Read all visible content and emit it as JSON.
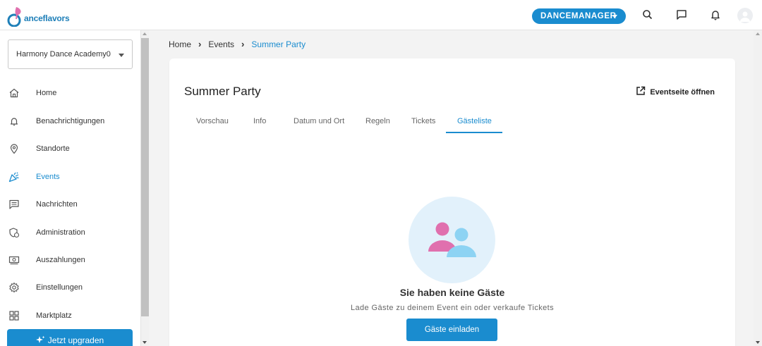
{
  "header": {
    "logo_text": "anceflavors",
    "role_button": "DANCEMANAGER",
    "icons": [
      "search-icon",
      "messages-icon",
      "notifications-icon",
      "user-avatar"
    ]
  },
  "sidebar": {
    "school": "Harmony Dance Academy0",
    "items": [
      {
        "label": "Home",
        "icon": "home-icon",
        "active": false
      },
      {
        "label": "Benachrichtigungen",
        "icon": "bell-icon",
        "active": false
      },
      {
        "label": "Standorte",
        "icon": "location-pin-icon",
        "active": false
      },
      {
        "label": "Events",
        "icon": "party-popper-icon",
        "active": true
      },
      {
        "label": "Nachrichten",
        "icon": "message-icon",
        "active": false
      },
      {
        "label": "Administration",
        "icon": "admin-shield-icon",
        "active": false
      },
      {
        "label": "Auszahlungen",
        "icon": "cash-icon",
        "active": false
      },
      {
        "label": "Einstellungen",
        "icon": "gear-icon",
        "active": false
      },
      {
        "label": "Marktplatz",
        "icon": "grid-icon",
        "active": false
      }
    ],
    "upgrade_label": "Jetzt upgraden"
  },
  "breadcrumb": {
    "items": [
      "Home",
      "Events",
      "Summer Party"
    ]
  },
  "event": {
    "title": "Summer Party",
    "open_page_label": "Eventseite öffnen",
    "tabs": [
      "Vorschau",
      "Info",
      "Datum und Ort",
      "Regeln",
      "Tickets",
      "Gästeliste"
    ],
    "active_tab": "Gästeliste"
  },
  "empty_state": {
    "title": "Sie haben keine Gäste",
    "subtitle": "Lade Gäste zu deinem Event ein oder verkaufe Tickets",
    "button": "Gäste einladen"
  },
  "colors": {
    "accent": "#1a8ccf",
    "empty_circle": "#e2f1fb",
    "guest_pink": "#e070ae",
    "guest_blue": "#8dd3f3"
  }
}
